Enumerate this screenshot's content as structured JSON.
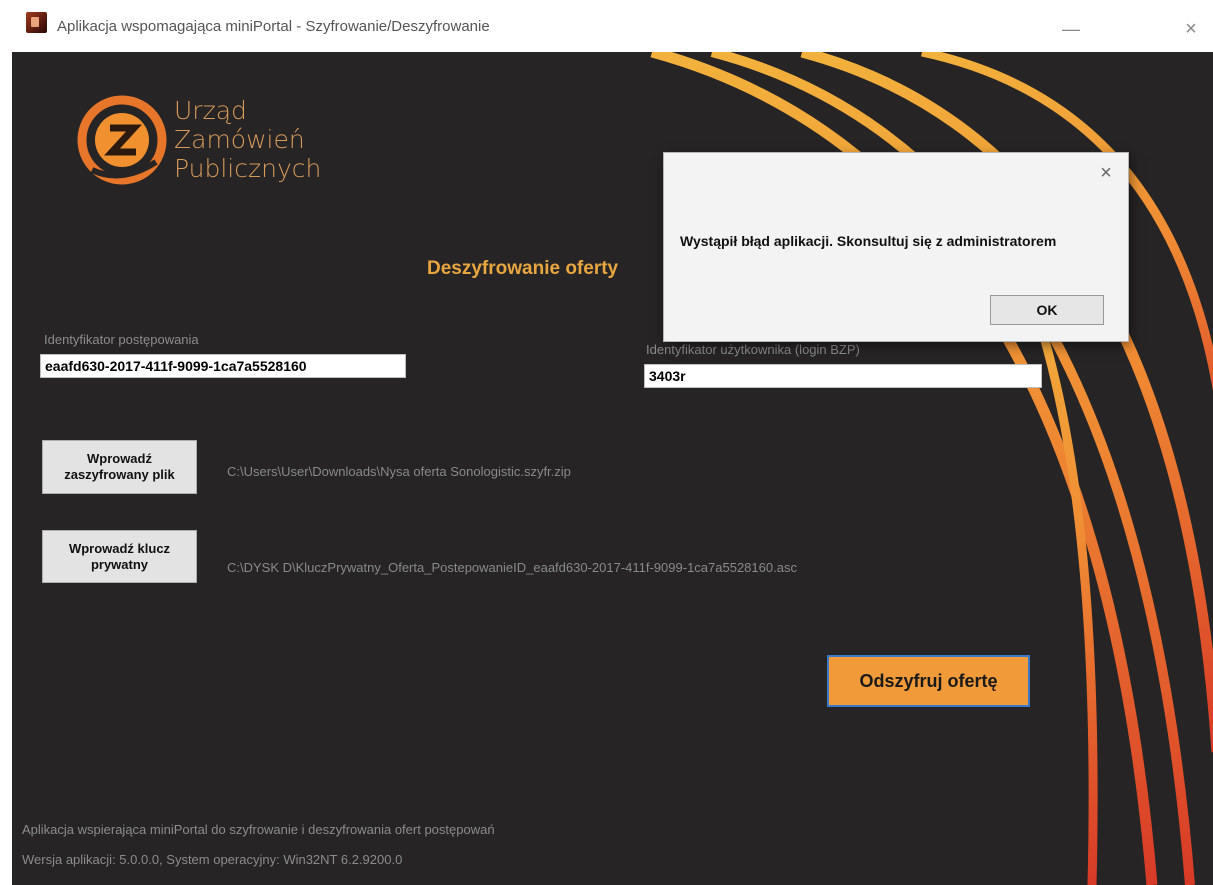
{
  "window": {
    "title": "Aplikacja wspomagająca miniPortal - Szyfrowanie/Deszyfrowanie",
    "minimize_glyph": "—",
    "close_glyph": "×"
  },
  "logo": {
    "line1": "Urząd",
    "line2": "Zamówień",
    "line3": "Publicznych"
  },
  "main": {
    "section_title": "Deszyfrowanie oferty",
    "proceeding_id_label": "Identyfikator postępowania",
    "proceeding_id_value": "eaafd630-2017-411f-9099-1ca7a5528160",
    "user_id_label": "Identyfikator użytkownika (login BZP)",
    "user_id_value": "3403r",
    "load_file_button": "Wprowadź\nzaszyfrowany plik",
    "encrypted_file_path": "C:\\Users\\User\\Downloads\\Nysa oferta Sonologistic.szyfr.zip",
    "load_key_button": "Wprowadź klucz\nprywatny",
    "private_key_path": "C:\\DYSK D\\KluczPrywatny_Oferta_PostepowanieID_eaafd630-2017-411f-9099-1ca7a5528160.asc",
    "decrypt_button": "Odszyfruj ofertę"
  },
  "footer": {
    "description": "Aplikacja wspierająca miniPortal do szyfrowanie i deszyfrowania ofert postępowań",
    "version": "Wersja aplikacji: 5.0.0.0, System operacyjny: Win32NT  6.2.9200.0"
  },
  "dialog": {
    "message": "Wystąpił błąd aplikacji. Skonsultuj się z administratorem",
    "ok_label": "OK",
    "close_glyph": "×"
  },
  "colors": {
    "panel_bg": "#262424",
    "accent_orange": "#f09a3a",
    "title_orange": "#e8a640",
    "arc_yellow": "#f0a83a",
    "arc_red": "#d9402a"
  },
  "icons": [
    "app-icon",
    "minimize-icon",
    "close-icon",
    "uzp-logo-icon",
    "dialog-close-icon"
  ]
}
